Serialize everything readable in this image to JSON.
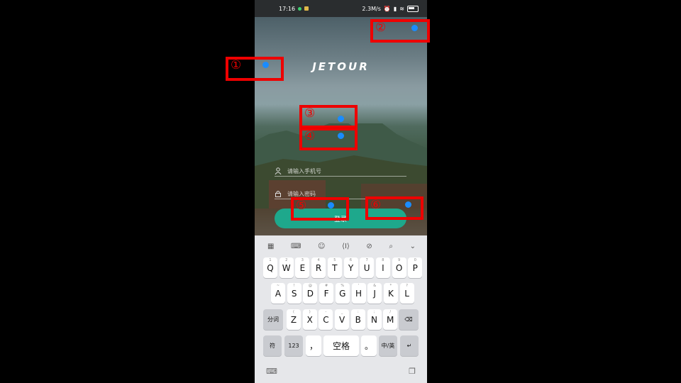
{
  "status_bar": {
    "time": "17:16",
    "network_speed": "2.3M/s",
    "signal": "5G",
    "battery_label": ""
  },
  "app": {
    "logo": "JETOUR",
    "phone_placeholder": "请输入手机号",
    "password_placeholder": "请输入密码",
    "login_label": "登录"
  },
  "keyboard": {
    "toolbar_icons": [
      "grid-icon",
      "keyboard-layout-icon",
      "emoji-icon",
      "cursor-icon",
      "link-icon",
      "search-icon",
      "chevron-down-icon"
    ],
    "row1": [
      {
        "k": "Q",
        "h": "1"
      },
      {
        "k": "W",
        "h": "2"
      },
      {
        "k": "E",
        "h": "3"
      },
      {
        "k": "R",
        "h": "4"
      },
      {
        "k": "T",
        "h": "5"
      },
      {
        "k": "Y",
        "h": "6"
      },
      {
        "k": "U",
        "h": "7"
      },
      {
        "k": "I",
        "h": "8"
      },
      {
        "k": "O",
        "h": "9"
      },
      {
        "k": "P",
        "h": "0"
      }
    ],
    "row2": [
      {
        "k": "A",
        "h": "~"
      },
      {
        "k": "S",
        "h": "!"
      },
      {
        "k": "D",
        "h": "@"
      },
      {
        "k": "F",
        "h": "#"
      },
      {
        "k": "G",
        "h": "%"
      },
      {
        "k": "H",
        "h": "'"
      },
      {
        "k": "J",
        "h": "&"
      },
      {
        "k": "K",
        "h": "*"
      },
      {
        "k": "L",
        "h": "?"
      }
    ],
    "row3": [
      {
        "k": "Z",
        "h": "("
      },
      {
        "k": "X",
        "h": ")"
      },
      {
        "k": "C",
        "h": "-"
      },
      {
        "k": "V",
        "h": "_"
      },
      {
        "k": "B",
        "h": ":"
      },
      {
        "k": "N",
        "h": ";"
      },
      {
        "k": "M",
        "h": "/"
      }
    ],
    "segment_key": "分词",
    "symbols_key": "符",
    "numbers_key": "123",
    "comma_key": "，",
    "space_key": "空格",
    "period_key": "。",
    "lang_key": "中/英",
    "enter_key": "↵",
    "backspace_key": "⌫"
  },
  "annotations": [
    "①",
    "②",
    "③",
    "④",
    "⑤",
    "⑥"
  ],
  "colors": {
    "annotation": "#e00000",
    "dot": "#1a8cff",
    "login_button": "#1ea88c"
  }
}
